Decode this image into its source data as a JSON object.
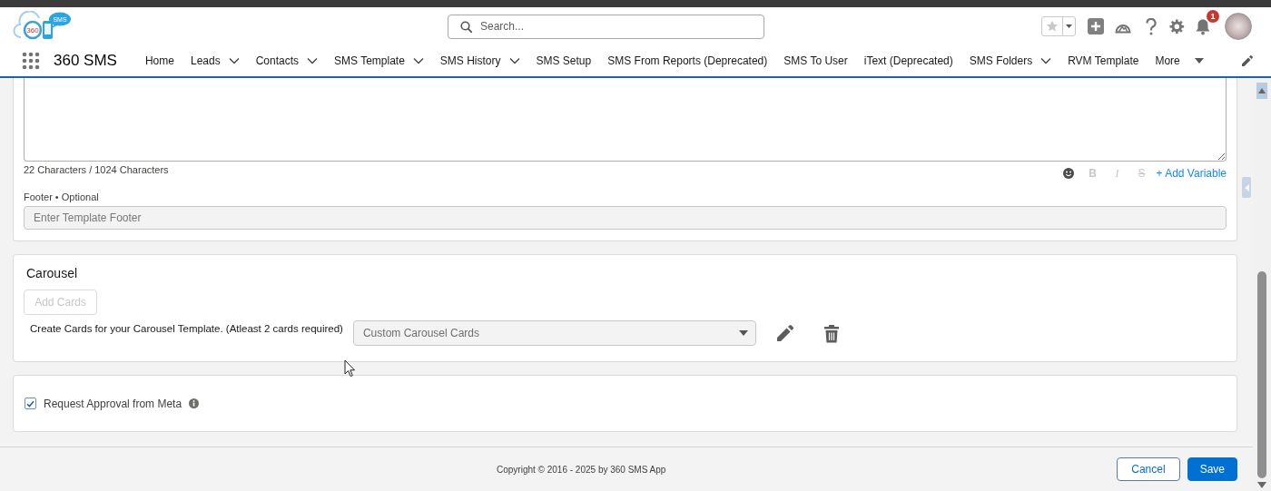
{
  "header": {
    "logo": {
      "ring_text": "360",
      "bubble_text": "SMS"
    },
    "search": {
      "placeholder": "Search..."
    },
    "notifications": {
      "count": "1"
    }
  },
  "nav": {
    "app_name": "360 SMS",
    "items": [
      {
        "label": "Home",
        "has_menu": false,
        "selected": false
      },
      {
        "label": "Leads",
        "has_menu": true,
        "selected": false
      },
      {
        "label": "Contacts",
        "has_menu": true,
        "selected": false
      },
      {
        "label": "SMS Template",
        "has_menu": true,
        "selected": false
      },
      {
        "label": "SMS History",
        "has_menu": true,
        "selected": false
      },
      {
        "label": "SMS Setup",
        "has_menu": false,
        "selected": false
      },
      {
        "label": "SMS From Reports (Deprecated)",
        "has_menu": false,
        "selected": false
      },
      {
        "label": "SMS To User",
        "has_menu": false,
        "selected": false
      },
      {
        "label": "iText (Deprecated)",
        "has_menu": false,
        "selected": false
      },
      {
        "label": "SMS Folders",
        "has_menu": true,
        "selected": false
      },
      {
        "label": "RVM Template",
        "has_menu": false,
        "selected": false
      }
    ],
    "more": {
      "label": "More"
    }
  },
  "editor": {
    "counter": "22 Characters / 1024 Characters",
    "tools": [
      {
        "kind": "emoji",
        "disabled": false
      },
      {
        "kind": "bold",
        "label": "B",
        "disabled": true
      },
      {
        "kind": "italic",
        "label": "I",
        "disabled": true
      },
      {
        "kind": "strike",
        "label": "S",
        "disabled": true
      }
    ],
    "add_variable": "+ Add Variable",
    "footer_field": {
      "label": "Footer • Optional",
      "placeholder": "Enter Template Footer",
      "disabled": true
    }
  },
  "carousel": {
    "title": "Carousel",
    "add_button": {
      "label": "Add Cards",
      "disabled": true
    },
    "hint": "Create Cards for your Carousel Template. (Atleast 2 cards required)",
    "select": {
      "value": "Custom Carousel Cards",
      "disabled": true
    }
  },
  "approval": {
    "label": "Request Approval from Meta",
    "checked": true
  },
  "footer": {
    "copyright": "Copyright © 2016 - 2025 by 360 SMS App",
    "buttons": [
      {
        "label": "Cancel",
        "kind": "neutral"
      },
      {
        "label": "Save",
        "kind": "brand"
      }
    ]
  }
}
